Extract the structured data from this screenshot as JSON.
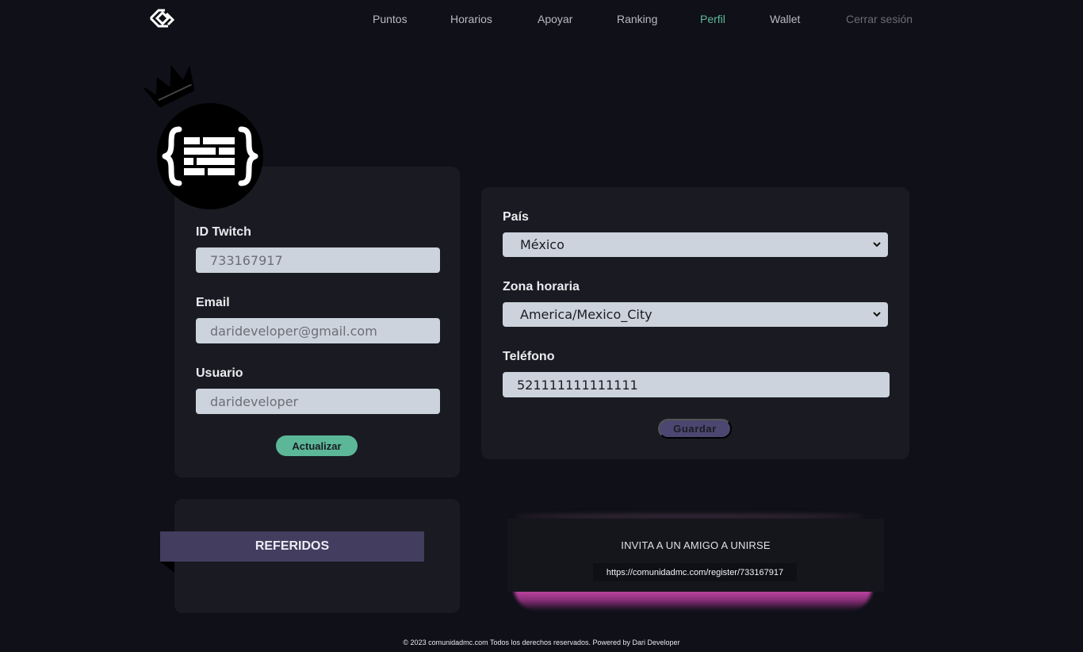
{
  "nav": {
    "items": [
      {
        "label": "Puntos"
      },
      {
        "label": "Horarios"
      },
      {
        "label": "Apoyar"
      },
      {
        "label": "Ranking"
      },
      {
        "label": "Perfil"
      },
      {
        "label": "Wallet"
      },
      {
        "label": "Cerrar sesión"
      }
    ],
    "active": "Perfil",
    "accent_color": "#62b999"
  },
  "account": {
    "twitch_label": "ID Twitch",
    "twitch_value": "733167917",
    "email_label": "Email",
    "email_value": "darideveloper@gmail.com",
    "user_label": "Usuario",
    "user_value": "darideveloper",
    "update_button": "Actualizar"
  },
  "settings": {
    "country_label": "País",
    "country_value": "México",
    "timezone_label": "Zona horaria",
    "timezone_value": "America/Mexico_City",
    "phone_label": "Teléfono",
    "phone_value": "521111111111111",
    "save_button": "Guardar"
  },
  "referrals": {
    "title": "REFERIDOS"
  },
  "invite": {
    "title": "INVITA A UN AMIGO A UNIRSE",
    "link": "https://comunidadmc.com/register/733167917"
  },
  "footer": {
    "text": "© 2023 comunidadmc.com Todos los derechos reservados. Powered by Dari Developer"
  }
}
